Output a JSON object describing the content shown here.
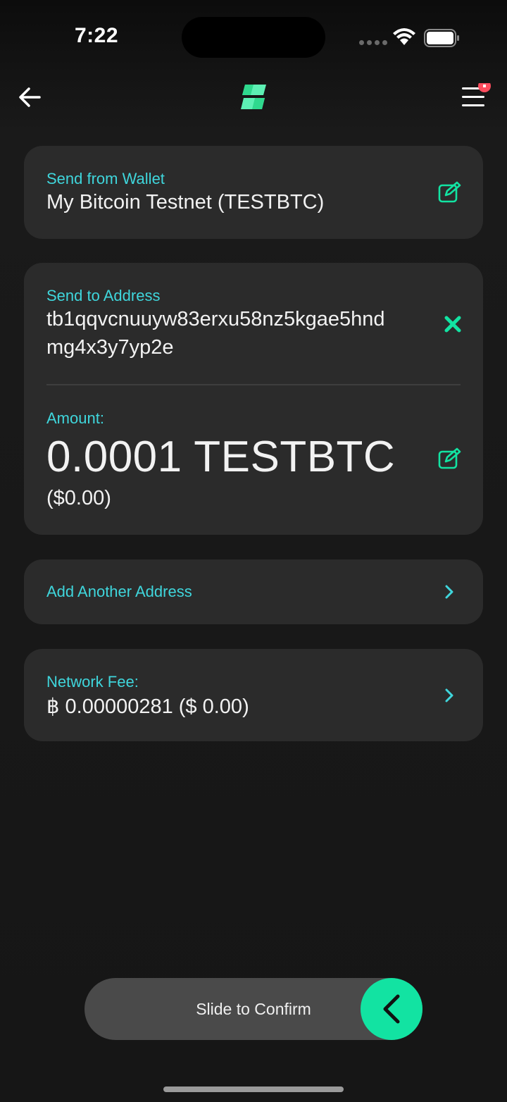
{
  "status": {
    "time": "7:22"
  },
  "wallet": {
    "label": "Send from Wallet",
    "value": "My Bitcoin Testnet (TESTBTC)"
  },
  "recipient": {
    "label": "Send to Address",
    "address_line1": "tb1qqvcnuuyw83erxu58nz5kgae5hnd",
    "address_line2": "mg4x3y7yp2e",
    "amount_label": "Amount:",
    "amount_value": "0.0001 TESTBTC",
    "amount_fiat": "($0.00)"
  },
  "add_address": {
    "label": "Add Another Address"
  },
  "fee": {
    "label": "Network Fee:",
    "value": "฿ 0.00000281 ($ 0.00)"
  },
  "slider": {
    "label": "Slide to Confirm"
  },
  "colors": {
    "accent": "#12e3a2",
    "label": "#3fd6dc",
    "card": "#2b2b2b",
    "badge": "#ff4d5e"
  }
}
